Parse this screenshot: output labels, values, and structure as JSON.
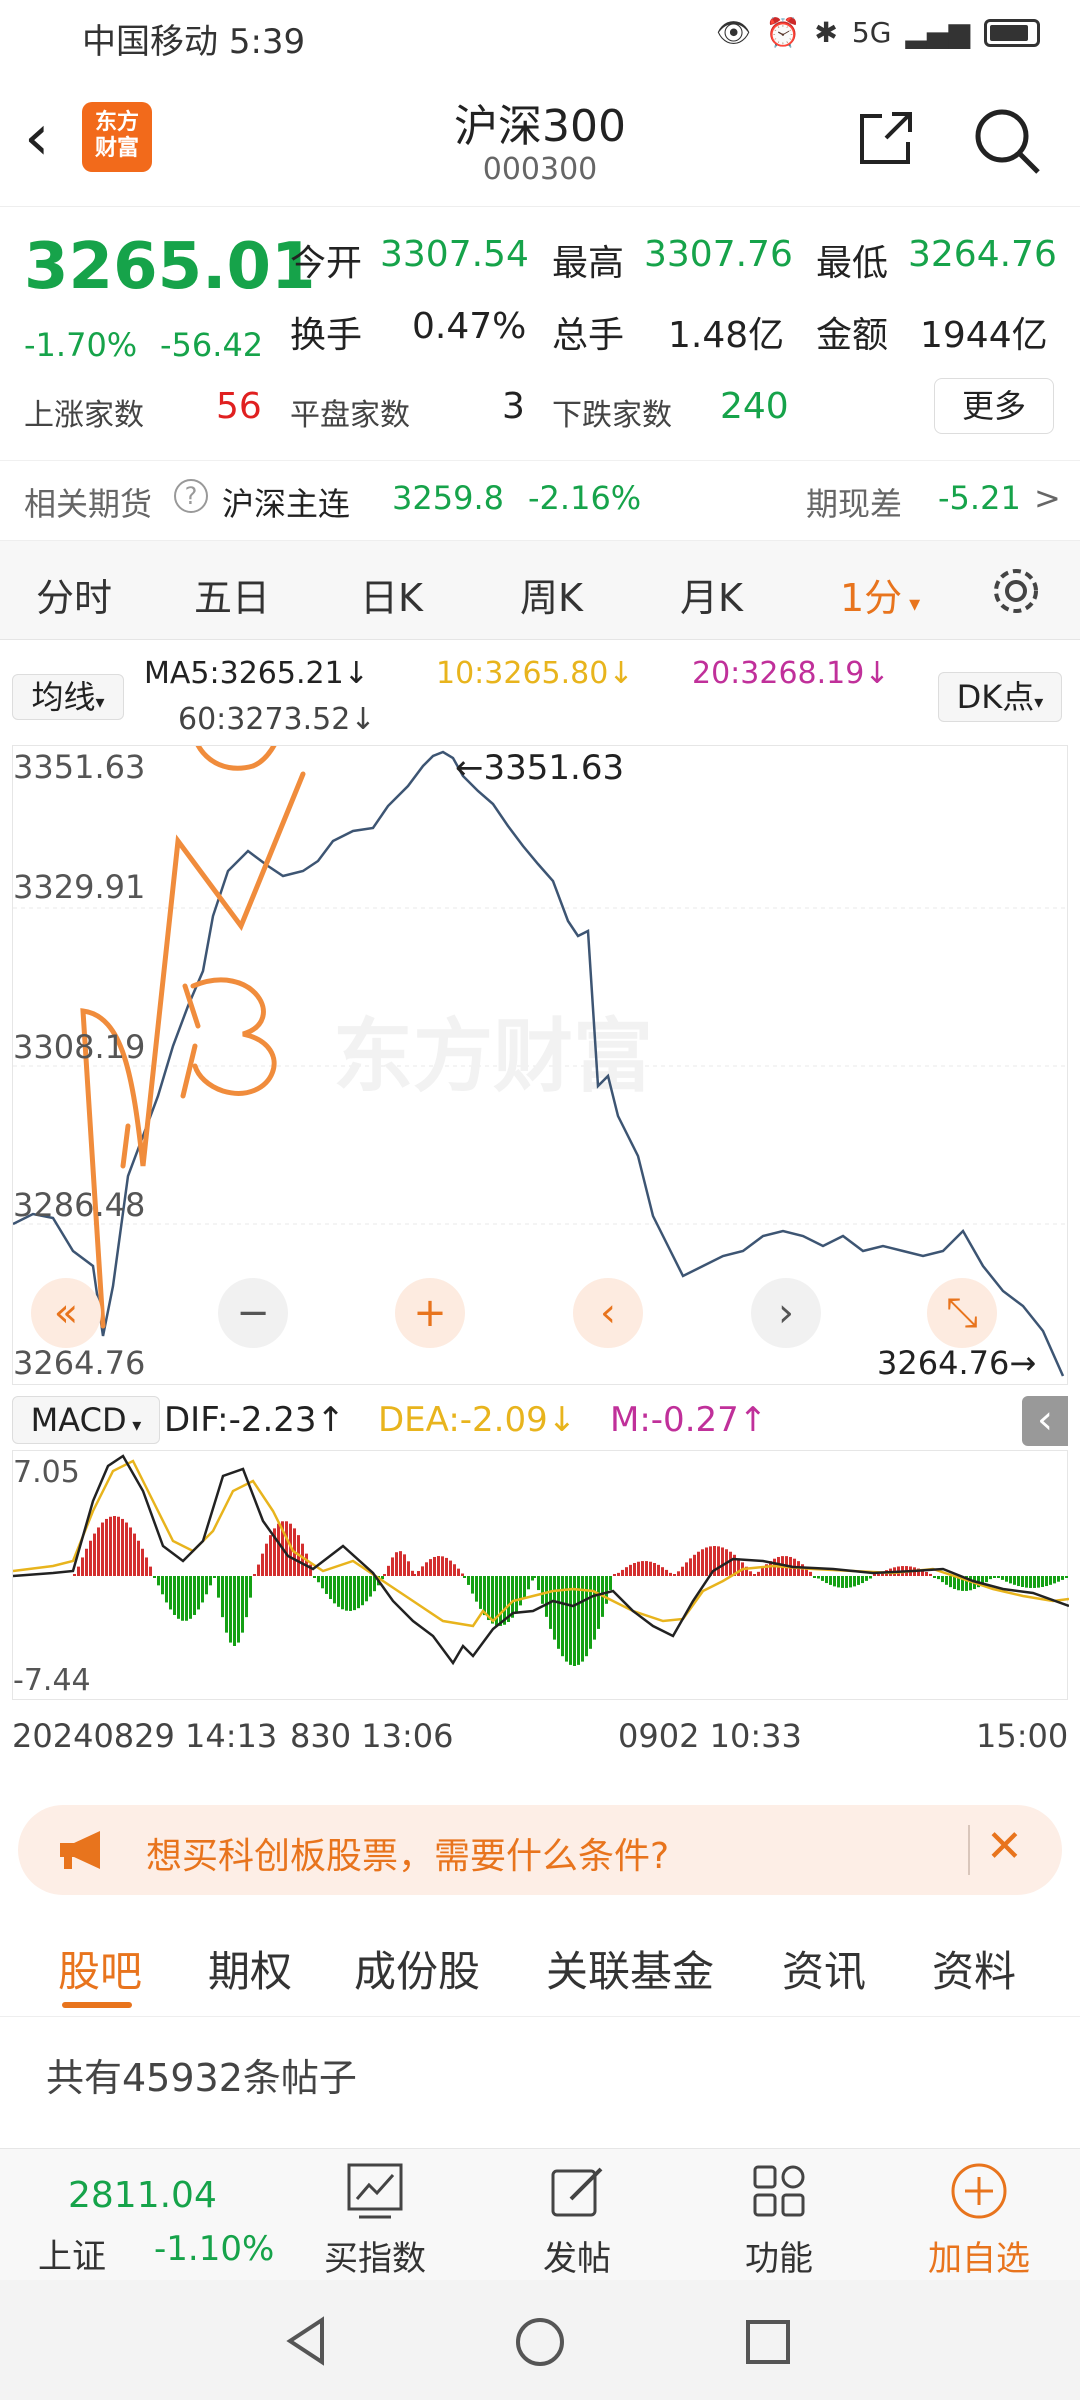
{
  "status_bar": {
    "carrier": "中国移动",
    "time": "5:39",
    "signal_text": "5G"
  },
  "header": {
    "logo_text_line1": "东方",
    "logo_text_line2": "财富",
    "title": "沪深300",
    "code": "000300"
  },
  "quote": {
    "price": "3265.01",
    "change_pct": "-1.70%",
    "change_abs": "-56.42",
    "open_label": "今开",
    "open": "3307.54",
    "high_label": "最高",
    "high": "3307.76",
    "low_label": "最低",
    "low": "3264.76",
    "turnover_label": "换手",
    "turnover": "0.47%",
    "volume_label": "总手",
    "volume": "1.48亿",
    "amount_label": "金额",
    "amount": "1944亿",
    "up_label": "上涨家数",
    "up_count": "56",
    "flat_label": "平盘家数",
    "flat_count": "3",
    "down_label": "下跌家数",
    "down_count": "240",
    "more_label": "更多"
  },
  "futures": {
    "label": "相关期货",
    "help": "?",
    "name": "沪深主连",
    "value": "3259.8",
    "pct": "-2.16%",
    "basis_label": "期现差",
    "basis": "-5.21",
    "arrow": ">"
  },
  "k_tabs": {
    "items": [
      "分时",
      "五日",
      "日K",
      "周K",
      "月K",
      "1分"
    ],
    "active_index": 5
  },
  "ma": {
    "toggle": "均线",
    "ma5": "MA5:3265.21↓",
    "ma10": "10:3265.80↓",
    "ma20": "20:3268.19↓",
    "ma60": "60:3273.52↓",
    "dk": "DK点"
  },
  "chart": {
    "y_labels": [
      "3351.63",
      "3329.91",
      "3308.19",
      "3286.48",
      "3264.76"
    ],
    "max_marker": "←3351.63",
    "min_marker": "3264.76→",
    "watermark": "东方财富",
    "controls": [
      "«",
      "−",
      "+",
      "‹",
      "›",
      "⤡"
    ],
    "colors": {
      "line": "#3d5573",
      "annotation": "#f08c3c"
    }
  },
  "macd": {
    "toggle": "MACD",
    "dif": "DIF:-2.23↑",
    "dea": "DEA:-2.09↓",
    "m": "M:-0.27↑",
    "y_top": "7.05",
    "y_bottom": "-7.44",
    "collapse": "‹"
  },
  "x_axis": {
    "left": "20240829 14:13",
    "mid1": "830 13:06",
    "mid2": "0902 10:33",
    "right": "15:00"
  },
  "banner": {
    "text": "想买科创板股票，需要什么条件?",
    "close": "✕"
  },
  "bottom_tabs": {
    "items": [
      "股吧",
      "期权",
      "成份股",
      "关联基金",
      "资讯",
      "资料"
    ],
    "active_index": 0
  },
  "posts": {
    "text": "共有45932条帖子"
  },
  "toolbar": {
    "index_value": "2811.04",
    "index_name": "上证",
    "index_pct": "-1.10%",
    "buy_index": "买指数",
    "post": "发帖",
    "functions": "功能",
    "add_watch": "加自选"
  }
}
